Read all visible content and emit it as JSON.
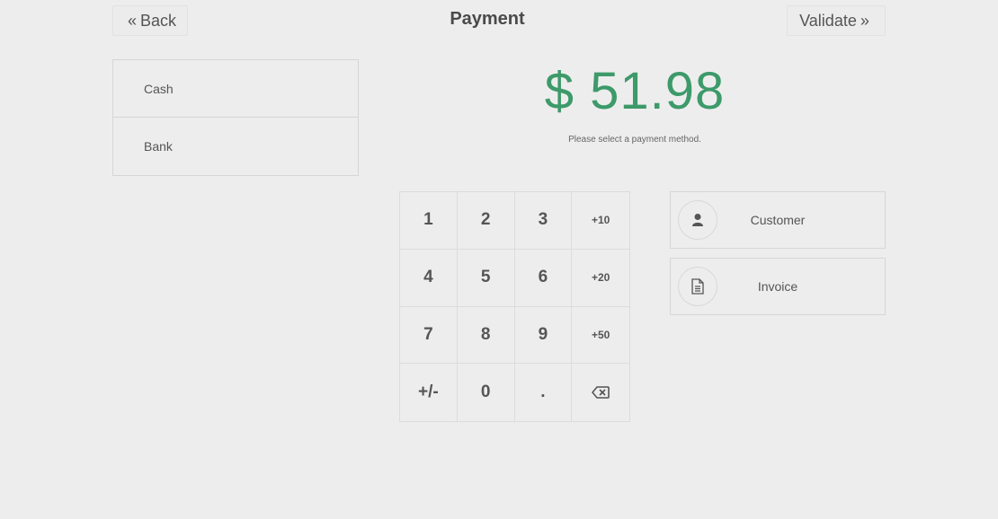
{
  "header": {
    "back_label": "Back",
    "title": "Payment",
    "validate_label": "Validate"
  },
  "payment_methods": [
    {
      "label": "Cash"
    },
    {
      "label": "Bank"
    }
  ],
  "amount": {
    "display": "$ 51.98",
    "hint": "Please select a payment method."
  },
  "numpad": {
    "keys": [
      "1",
      "2",
      "3",
      "+10",
      "4",
      "5",
      "6",
      "+20",
      "7",
      "8",
      "9",
      "+50",
      "+/-",
      "0",
      ".",
      "backspace"
    ]
  },
  "actions": {
    "customer_label": "Customer",
    "invoice_label": "Invoice"
  },
  "colors": {
    "background": "#eeeded",
    "amount": "#3d9a6a",
    "text": "#555555"
  },
  "icons": {
    "back": "double-chevron-left-icon",
    "validate": "double-chevron-right-icon",
    "customer": "user-icon",
    "invoice": "document-icon",
    "backspace": "backspace-icon"
  }
}
